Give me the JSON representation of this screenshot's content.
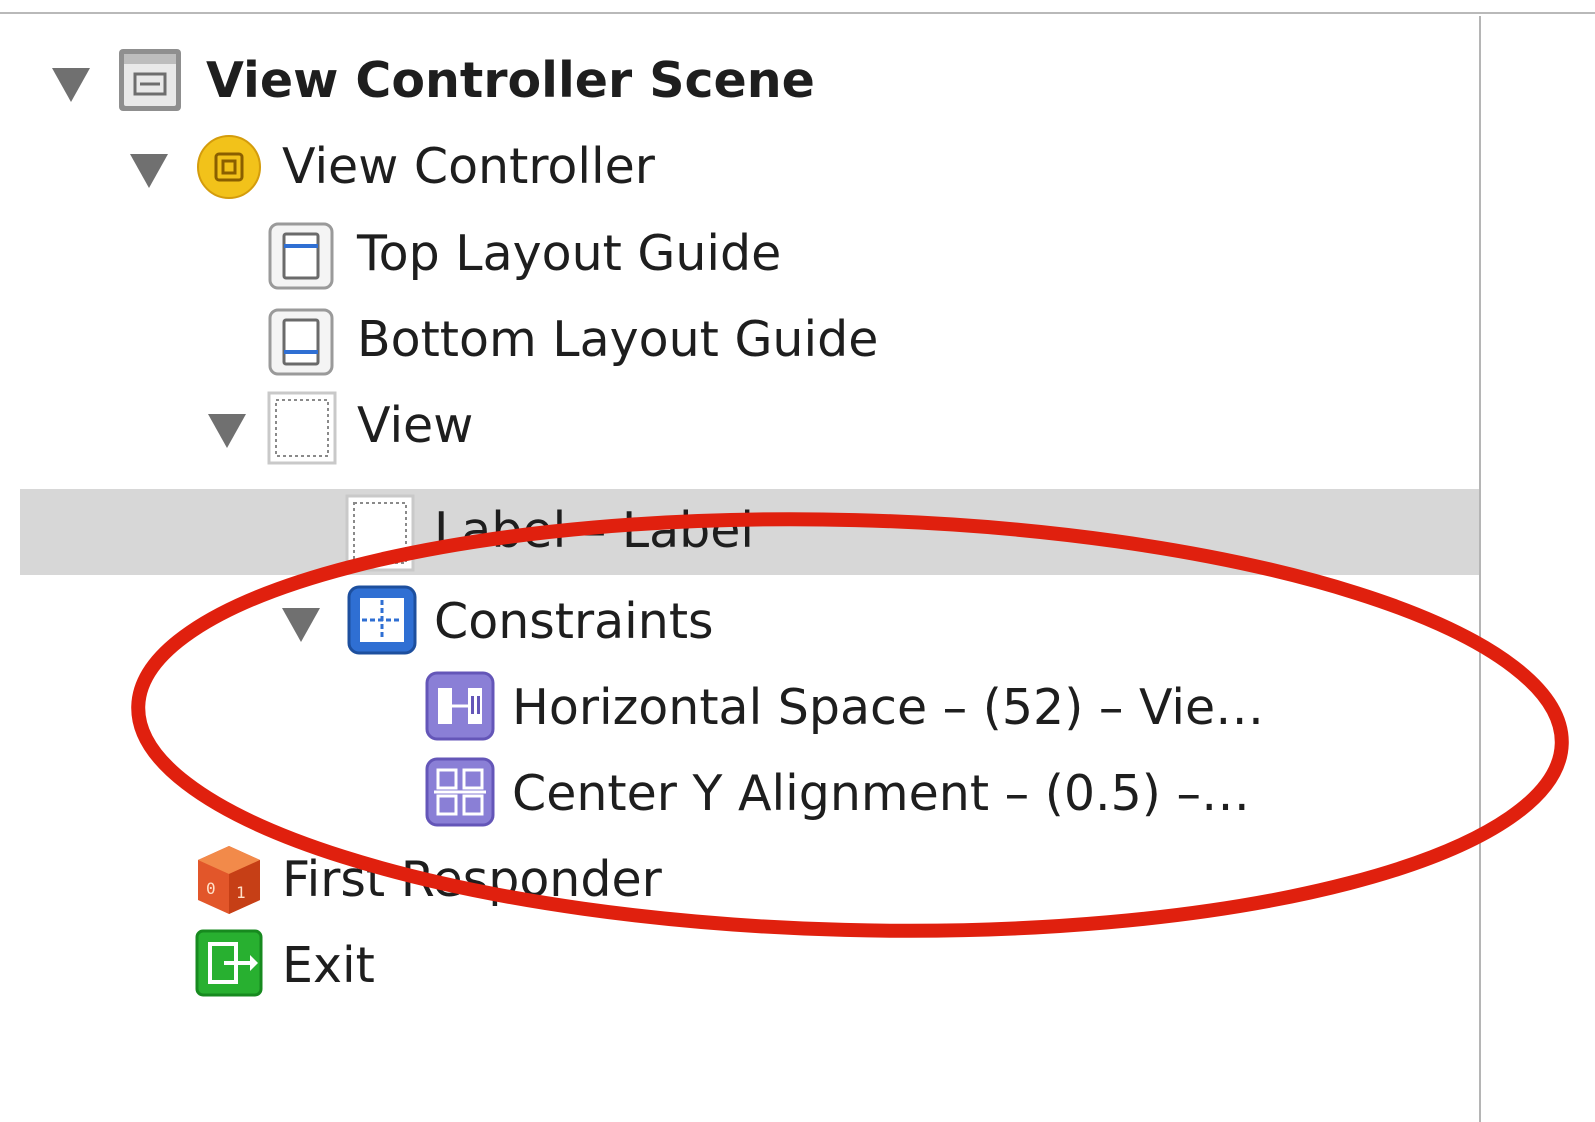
{
  "outline": {
    "items": [
      {
        "label": "View Controller Scene",
        "icon": "storyboard-scene-icon",
        "expanded": true
      },
      {
        "label": "View Controller",
        "icon": "view-controller-icon",
        "expanded": true
      },
      {
        "label": "Top Layout Guide",
        "icon": "top-layout-guide-icon"
      },
      {
        "label": "Bottom Layout Guide",
        "icon": "bottom-layout-guide-icon"
      },
      {
        "label": "View",
        "icon": "view-icon",
        "expanded": true
      },
      {
        "label": "Label – Label",
        "icon": "label-view-icon",
        "selected": true
      },
      {
        "label": "Constraints",
        "icon": "constraints-icon",
        "expanded": true
      },
      {
        "label": "Horizontal Space – (52) – Vie…",
        "icon": "horizontal-space-constraint-icon"
      },
      {
        "label": "Center Y Alignment – (0.5) –…",
        "icon": "center-y-alignment-constraint-icon"
      },
      {
        "label": "First Responder",
        "icon": "first-responder-cube-icon"
      },
      {
        "label": "Exit",
        "icon": "exit-icon"
      }
    ]
  },
  "colors": {
    "selection": "#d7d7d7",
    "annotation_ellipse": "#e0200e",
    "view_controller_yellow": "#f2c21a",
    "constraints_blue": "#2f6fd3",
    "constraint_purple": "#8a7fd6",
    "exit_green": "#28b030",
    "responder_orange": "#e2562a"
  }
}
